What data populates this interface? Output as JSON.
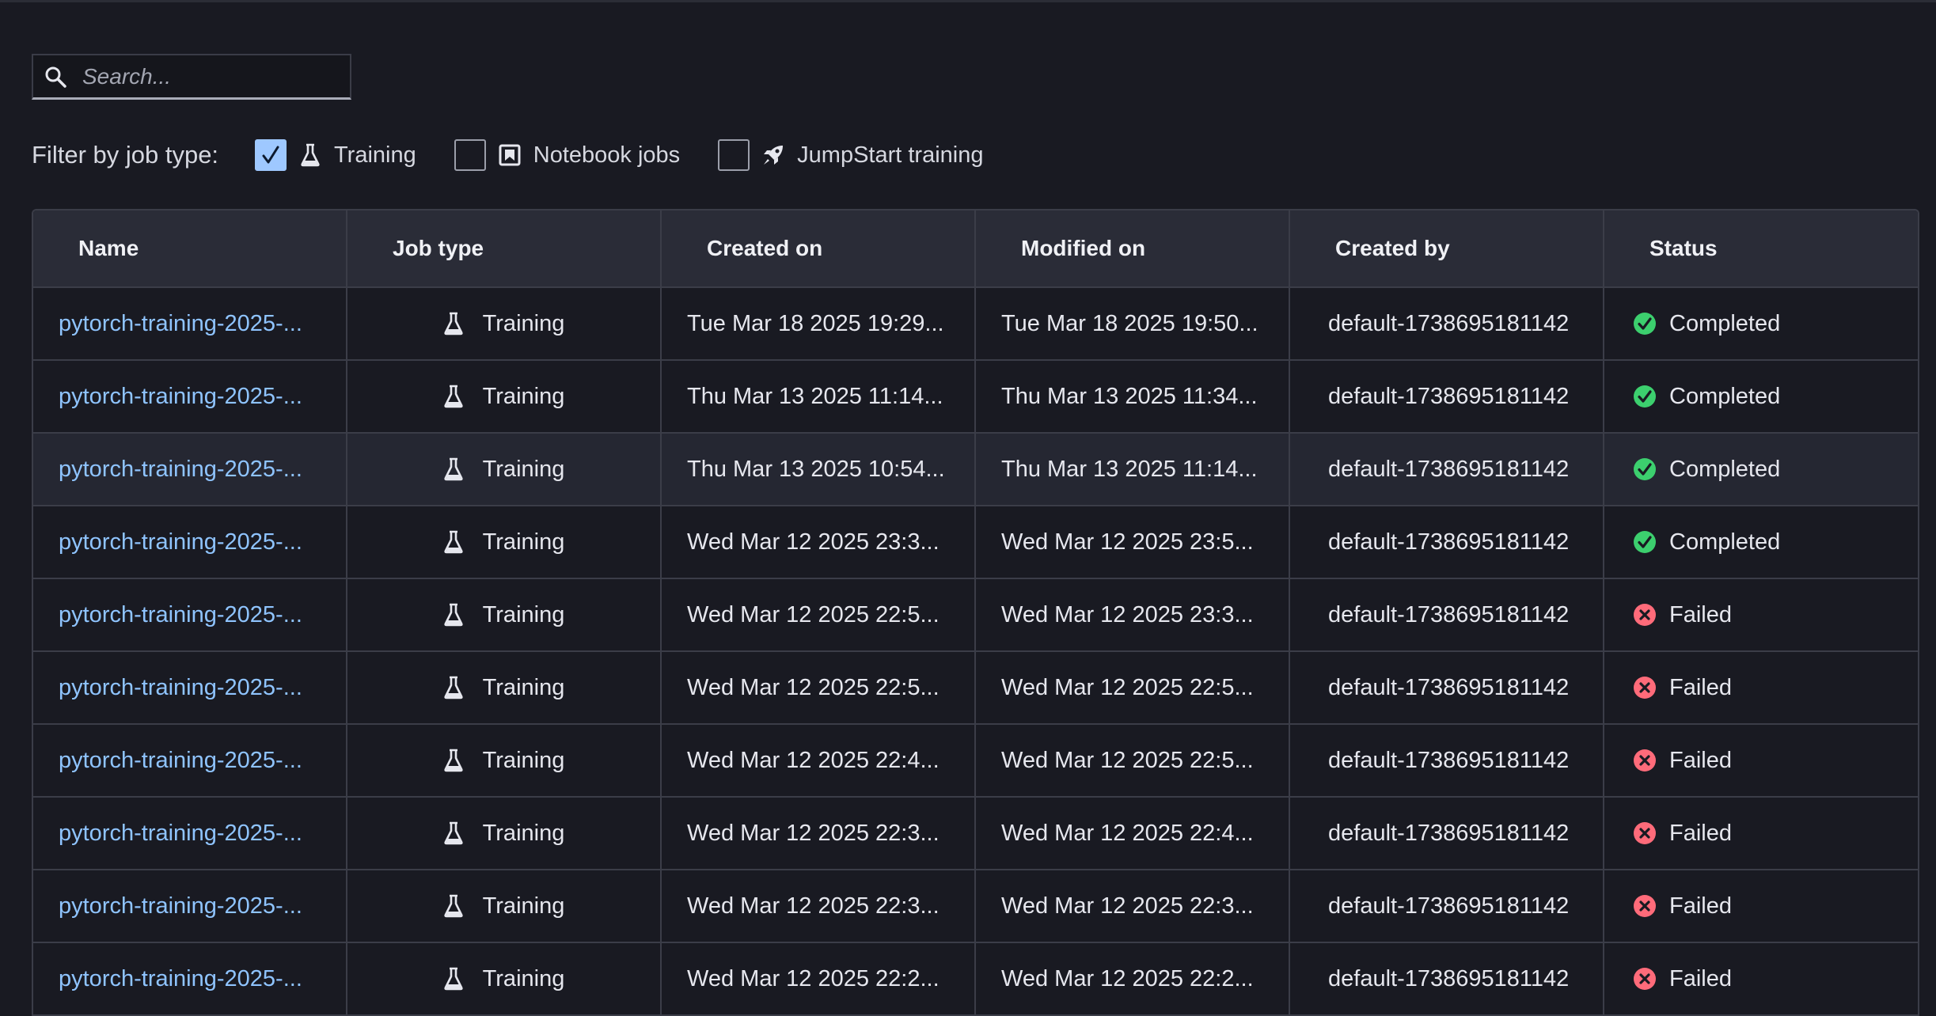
{
  "search": {
    "placeholder": "Search..."
  },
  "filters": {
    "label": "Filter by job type:",
    "options": [
      {
        "label": "Training",
        "checked": true,
        "icon": "flask-icon"
      },
      {
        "label": "Notebook jobs",
        "checked": false,
        "icon": "notebook-icon"
      },
      {
        "label": "JumpStart training",
        "checked": false,
        "icon": "rocket-icon"
      }
    ]
  },
  "table": {
    "columns": [
      "Name",
      "Job type",
      "Created on",
      "Modified on",
      "Created by",
      "Status"
    ],
    "rows": [
      {
        "name": "pytorch-training-2025-...",
        "job_type": "Training",
        "created_on": "Tue Mar 18 2025 19:29...",
        "modified_on": "Tue Mar 18 2025 19:50...",
        "created_by": "default-1738695181142",
        "status": "Completed"
      },
      {
        "name": "pytorch-training-2025-...",
        "job_type": "Training",
        "created_on": "Thu Mar 13 2025 11:14...",
        "modified_on": "Thu Mar 13 2025 11:34...",
        "created_by": "default-1738695181142",
        "status": "Completed"
      },
      {
        "name": "pytorch-training-2025-...",
        "job_type": "Training",
        "created_on": "Thu Mar 13 2025 10:54...",
        "modified_on": "Thu Mar 13 2025 11:14...",
        "created_by": "default-1738695181142",
        "status": "Completed"
      },
      {
        "name": "pytorch-training-2025-...",
        "job_type": "Training",
        "created_on": "Wed Mar 12 2025 23:3...",
        "modified_on": "Wed Mar 12 2025 23:5...",
        "created_by": "default-1738695181142",
        "status": "Completed"
      },
      {
        "name": "pytorch-training-2025-...",
        "job_type": "Training",
        "created_on": "Wed Mar 12 2025 22:5...",
        "modified_on": "Wed Mar 12 2025 23:3...",
        "created_by": "default-1738695181142",
        "status": "Failed"
      },
      {
        "name": "pytorch-training-2025-...",
        "job_type": "Training",
        "created_on": "Wed Mar 12 2025 22:5...",
        "modified_on": "Wed Mar 12 2025 22:5...",
        "created_by": "default-1738695181142",
        "status": "Failed"
      },
      {
        "name": "pytorch-training-2025-...",
        "job_type": "Training",
        "created_on": "Wed Mar 12 2025 22:4...",
        "modified_on": "Wed Mar 12 2025 22:5...",
        "created_by": "default-1738695181142",
        "status": "Failed"
      },
      {
        "name": "pytorch-training-2025-...",
        "job_type": "Training",
        "created_on": "Wed Mar 12 2025 22:3...",
        "modified_on": "Wed Mar 12 2025 22:4...",
        "created_by": "default-1738695181142",
        "status": "Failed"
      },
      {
        "name": "pytorch-training-2025-...",
        "job_type": "Training",
        "created_on": "Wed Mar 12 2025 22:3...",
        "modified_on": "Wed Mar 12 2025 22:3...",
        "created_by": "default-1738695181142",
        "status": "Failed"
      },
      {
        "name": "pytorch-training-2025-...",
        "job_type": "Training",
        "created_on": "Wed Mar 12 2025 22:2...",
        "modified_on": "Wed Mar 12 2025 22:2...",
        "created_by": "default-1738695181142",
        "status": "Failed"
      }
    ]
  },
  "colors": {
    "link": "#8fc4ff",
    "completed": "#3ccf6e",
    "failed": "#ff6b7a",
    "checkbox_checked": "#9ec8ff"
  }
}
